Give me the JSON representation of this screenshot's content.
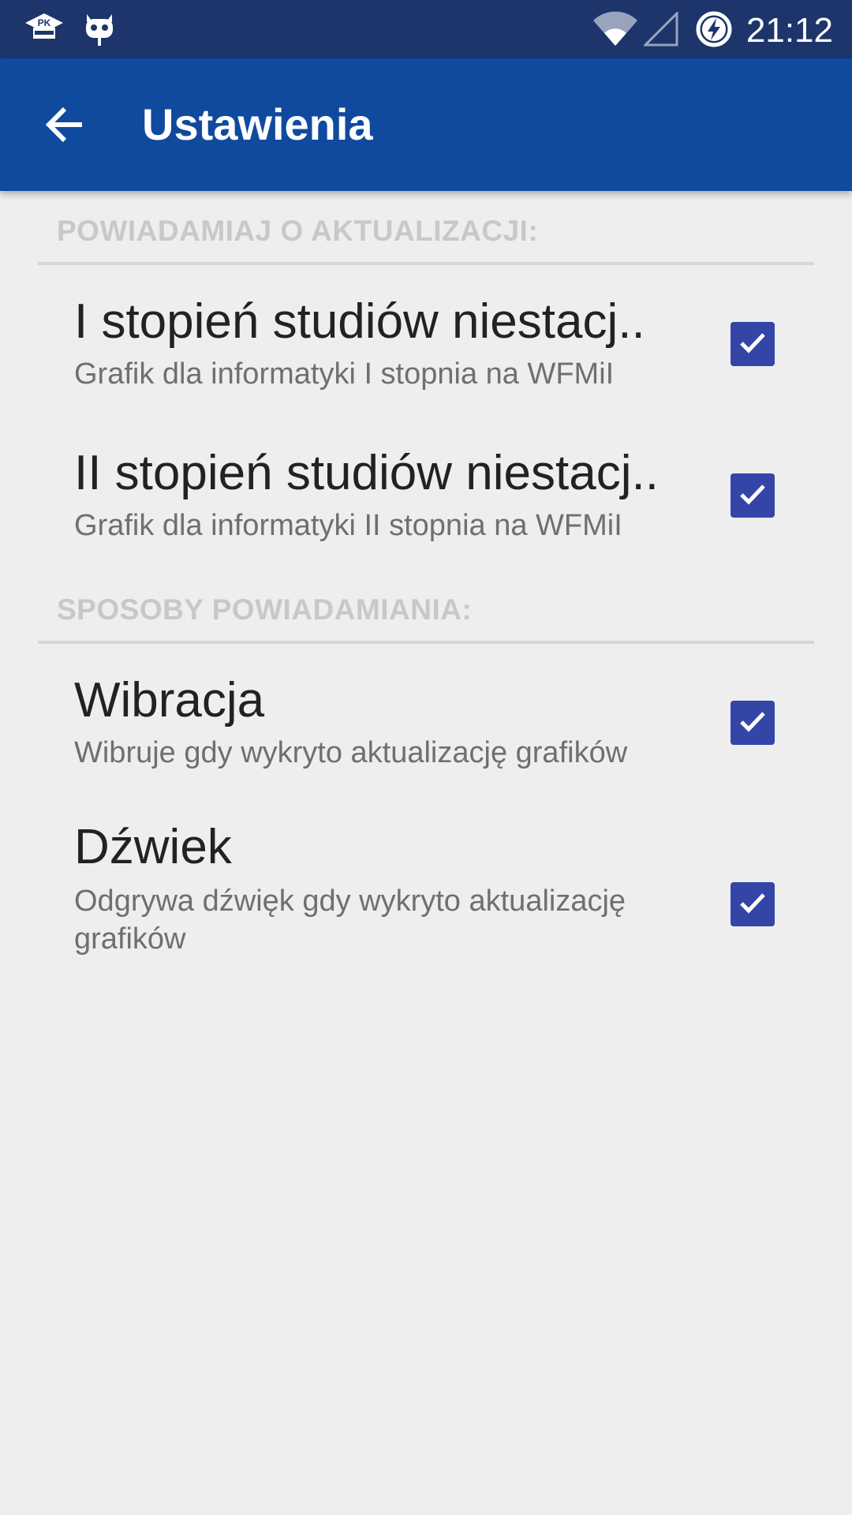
{
  "status_bar": {
    "time": "21:12",
    "left_icons": [
      "pk-wfmii-app-icon",
      "cyanogen-mascot-icon"
    ],
    "right_icons": [
      "wifi-icon",
      "cell-signal-icon",
      "battery-charging-icon"
    ],
    "app_badge_text": "PK"
  },
  "app_bar": {
    "title": "Ustawienia",
    "background": "#0f4a9e",
    "status_background": "#1d356b"
  },
  "sections": [
    {
      "header": "POWIADAMIAJ O AKTUALIZACJI:",
      "items": [
        {
          "title": "I stopień studiów niestacj..",
          "summary": "Grafik dla informatyki I stopnia na WFMiI",
          "checked": true
        },
        {
          "title": "II stopień studiów niestacj..",
          "summary": "Grafik dla informatyki II stopnia na WFMiI",
          "checked": true
        }
      ]
    },
    {
      "header": "SPOSOBY POWIADAMIANIA:",
      "items": [
        {
          "title": "Wibracja",
          "summary": "Wibruje gdy wykryto aktualizację grafików",
          "checked": true
        },
        {
          "title": "Dźwiek",
          "summary": "Odgrywa dźwięk gdy wykryto aktualizację grafików",
          "checked": true
        }
      ]
    }
  ],
  "colors": {
    "checkbox": "#3346a8",
    "background": "#eeeeee",
    "section_header": "#c8c8c8"
  }
}
